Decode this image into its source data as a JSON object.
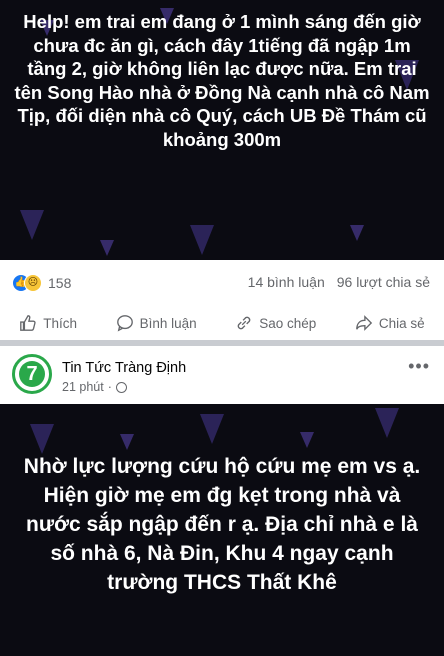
{
  "post1": {
    "text": "Help! em trai em đang ở 1 mình sáng đến giờ chưa đc ăn gì, cách đây 1tiếng đã ngập 1m tầng 2, giờ không liên lạc được nữa. Em trai tên Song Hào nhà ở Đồng Nà cạnh nhà cô Nam Tịp, đối diện nhà cô Quý, cách UB Đề Thám cũ khoảng 300m",
    "reaction_count": "158",
    "comments": "14 bình luận",
    "shares": "96 lượt chia sẻ"
  },
  "actions": {
    "like": "Thích",
    "comment": "Bình luận",
    "copy": "Sao chép",
    "share": "Chia sẻ"
  },
  "post2": {
    "page_name": "Tin Tức Tràng Định",
    "time": "21 phút",
    "avatar_text": "7",
    "text": "Nhờ lực lượng cứu hộ cứu mẹ em vs ạ. Hiện giờ mẹ em đg kẹt trong nhà và nước sắp ngập đến r ạ. Địa chỉ nhà e là số nhà 6, Nà Đin, Khu 4 ngay cạnh trường THCS Thất Khê"
  },
  "colors": {
    "post_background": "#0b0b12",
    "raindrop": "#3b2f73",
    "like_blue": "#1877f2",
    "avatar_green": "#2aa84a"
  }
}
